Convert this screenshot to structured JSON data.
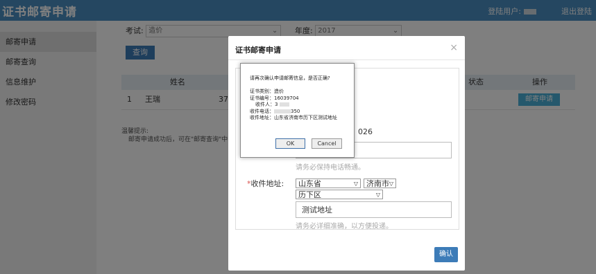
{
  "header": {
    "app_title": "证书邮寄申请",
    "user_label": "登陆用户:",
    "logout": "退出登陆"
  },
  "sidebar": {
    "items": [
      {
        "label": "邮寄申请",
        "active": true
      },
      {
        "label": "邮寄查询",
        "active": false
      },
      {
        "label": "信息维护",
        "active": false
      },
      {
        "label": "修改密码",
        "active": false
      }
    ]
  },
  "filters": {
    "exam_label": "考试:",
    "exam_value": "造价",
    "year_label": "年度:",
    "year_value": "2017",
    "search_button": "查询"
  },
  "table": {
    "headers": [
      "姓名",
      "状态",
      "操作"
    ],
    "rows": [
      {
        "index": "1",
        "name": "王瑞",
        "id_partial": "37",
        "action": "邮寄申请"
      }
    ]
  },
  "tips": {
    "title": "温馨提示:",
    "text": "邮寄申请成功后，可在\"邮寄查询\"中"
  },
  "modal": {
    "title": "证书邮寄申请",
    "close": "×",
    "phone_partial": "026",
    "phone_help": "请务必保持电话畅通。",
    "address_label": "收件地址:",
    "province": "山东省",
    "city": "济南市",
    "district": "历下区",
    "address_value": "测试地址",
    "address_help": "请务必详细准确，以方便投递。",
    "confirm_button": "确认"
  },
  "dialog": {
    "question": "请再次确认申请邮寄信息，是否正确?",
    "cert_type": "证书类别：造价",
    "cert_no": "证书编号：16039704",
    "recipient": "收件人：",
    "recipient_partial": "3",
    "phone": "收件电话：",
    "phone_partial": "350",
    "address": "收件地址：山东省济南市历下区测试地址",
    "ok": "OK",
    "cancel": "Cancel"
  }
}
